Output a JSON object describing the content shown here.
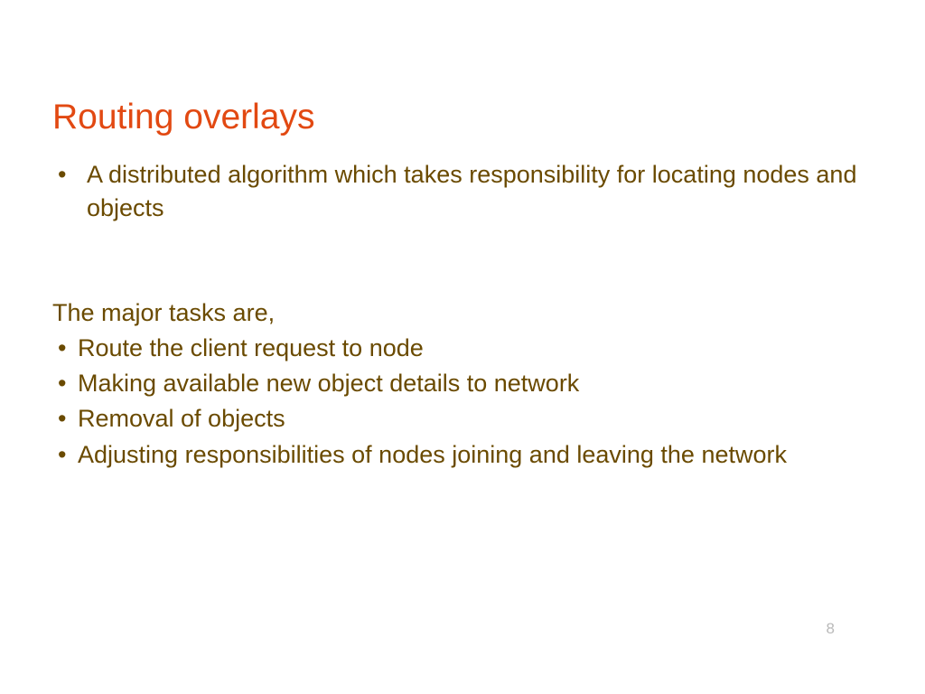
{
  "title": "Routing overlays",
  "intro": {
    "bullet": "•",
    "text": "A distributed algorithm which takes responsibility for locating nodes and objects"
  },
  "tasks_heading": "The major tasks are,",
  "tasks": [
    {
      "bullet": "•",
      "text": "Route the client request to node"
    },
    {
      "bullet": "•",
      "text": "Making available new object details to network"
    },
    {
      "bullet": "•",
      "text": "Removal of objects"
    },
    {
      "bullet": "•",
      "text": "Adjusting responsibilities of nodes joining and leaving the network"
    }
  ],
  "page_number": "8"
}
